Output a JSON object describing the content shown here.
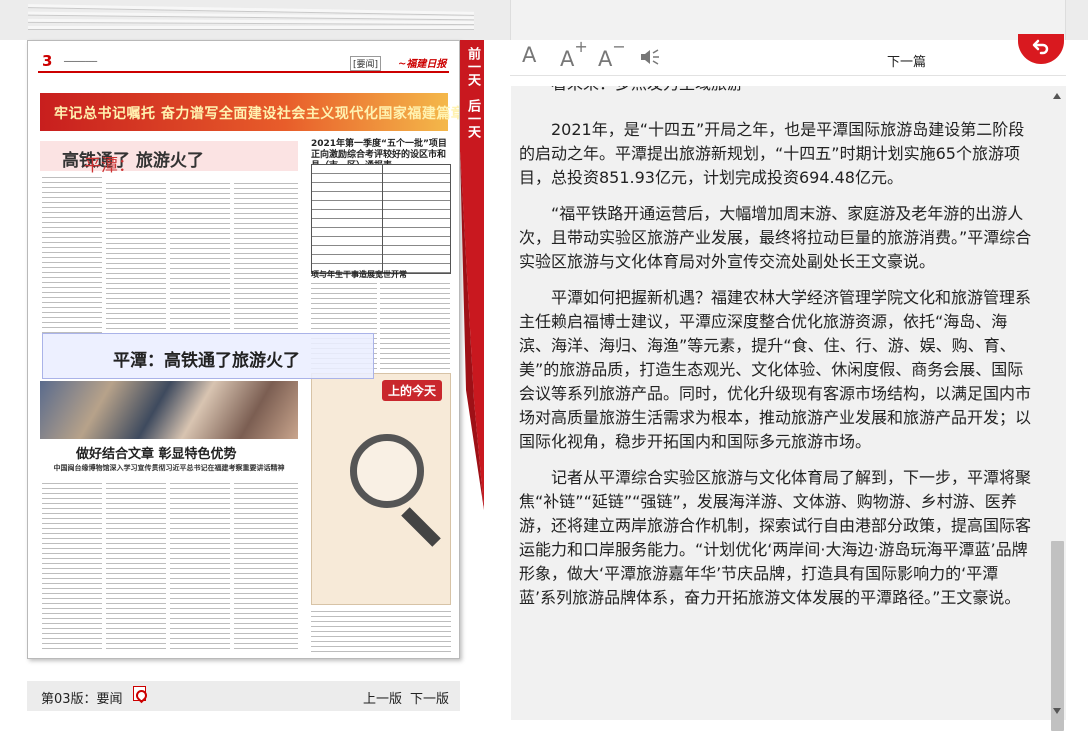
{
  "newspaper": {
    "page_number": "3",
    "section_tag": "[要闻]",
    "banner_headline": "牢记总书记嘱托 奋力谱写全面建设社会主义现代化国家福建篇章",
    "main_headline_place": "平潭：",
    "main_headline_rest": "高铁通了 旅游火了",
    "side_headline": "2021年第一季度“五个一批”项目正向激励综合考评较好的设区市和县（市、区）通报表",
    "side_headline2": "项与年生干事造展宽世开常",
    "highlight_title": "平潭：高铁通了旅游火了",
    "sub_headline": "做好结合文章 彰显特色优势",
    "sub_headline2": "中国闽台缘博物馆深入学习宣传贯彻习近平总书记在福建考察重要讲话精神",
    "photo_tag": "上的今天"
  },
  "day_flag": {
    "prev_day": "前一天",
    "next_day": "后一天"
  },
  "page_bar": {
    "page_name": "第03版：要闻",
    "prev_page": "上一版",
    "next_page": "下一版"
  },
  "toolbar": {
    "font_label": "A",
    "font_increase_label": "A",
    "font_increase_sign": "+",
    "font_decrease_label": "A",
    "font_decrease_sign": "−",
    "next_article": "下一篇"
  },
  "article": {
    "top_partial": "看未来：多点发力生域旅游",
    "paragraphs": [
      "2021年，是“十四五”开局之年，也是平潭国际旅游岛建设第二阶段的启动之年。平潭提出旅游新规划，“十四五”时期计划实施65个旅游项目，总投资851.93亿元，计划完成投资694.48亿元。",
      "“福平铁路开通运营后，大幅增加周末游、家庭游及老年游的出游人次，且带动实验区旅游产业发展，最终将拉动巨量的旅游消费。”平潭综合实验区旅游与文化体育局对外宣传交流处副处长王文豪说。",
      "平潭如何把握新机遇？福建农林大学经济管理学院文化和旅游管理系主任赖启福博士建议，平潭应深度整合优化旅游资源，依托“海岛、海滨、海洋、海归、海渔”等元素，提升“食、住、行、游、娱、购、育、美”的旅游品质，打造生态观光、文化体验、休闲度假、商务会展、国际会议等系列旅游产品。同时，优化升级现有客源市场结构，以满足国内市场对高质量旅游生活需求为根本，推动旅游产业发展和旅游产品开发；以国际化视角，稳步开拓国内和国际多元旅游市场。",
      "记者从平潭综合实验区旅游与文化体育局了解到，下一步，平潭将聚焦“补链”“延链”“强链”，发展海洋游、文体游、购物游、乡村游、医养游，还将建立两岸旅游合作机制，探索试行自由港部分政策，提高国际客运能力和口岸服务能力。“计划优化‘两岸间·大海边·游岛玩海平潭蓝’品牌形象，做大‘平潭旅游嘉年华’节庆品牌，打造具有国际影响力的‘平潭蓝’系列旅游品牌体系，奋力开拓旅游文体发展的平潭路径。”王文豪说。"
    ]
  },
  "colors": {
    "accent_red": "#c9181f",
    "article_bg": "#f1f1f1",
    "toolbar_icon": "#777777"
  },
  "icons": [
    "speaker-icon",
    "back-arrow-icon",
    "pdf-icon"
  ]
}
